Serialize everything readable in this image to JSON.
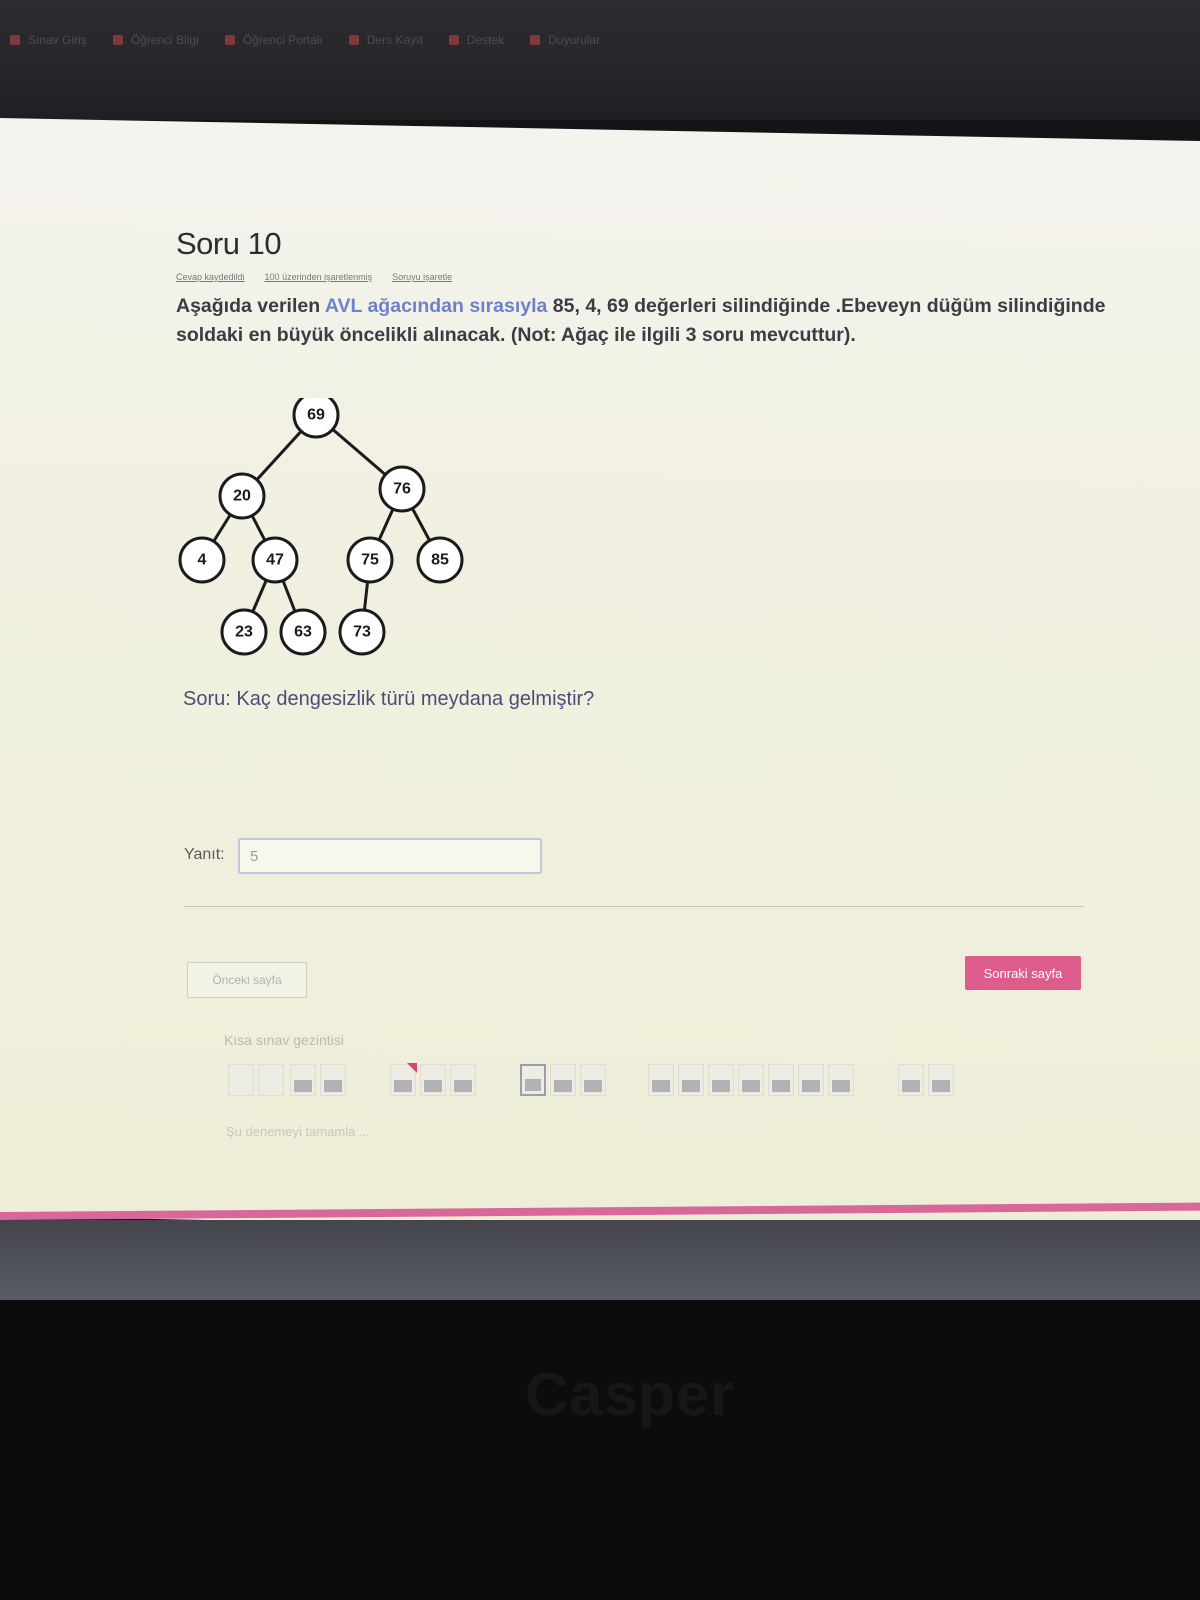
{
  "browser": {
    "bookmarks": [
      "Sınav Giriş",
      "Öğrenci Bilgi",
      "Öğrenci Portalı",
      "Ders Kayıt",
      "Destek",
      "Duyurular"
    ]
  },
  "question": {
    "title": "Soru 10",
    "meta": [
      "Cevap kaydedildi",
      "100 üzerinden işaretlenmiş",
      "Soruyu işaretle"
    ],
    "text_part1": "Aşağıda verilen ",
    "text_blue1": "AVL ağacından sırasıyla",
    "text_part2": " 85, 4, 69 değerleri silindiğinde .Ebeveyn düğüm silindiğinde soldaki en büyük öncelikli alınacak. (Not: Ağaç ile ilgili 3 soru mevcuttur).",
    "soru": "Soru: Kaç dengesizlik türü meydana gelmiştir?"
  },
  "tree": {
    "nodes": {
      "n69": "69",
      "n20": "20",
      "n76": "76",
      "n4": "4",
      "n47": "47",
      "n75": "75",
      "n85": "85",
      "n23": "23",
      "n63": "63",
      "n73": "73"
    }
  },
  "answer": {
    "label": "Yanıt:",
    "value": "5"
  },
  "navigation": {
    "prev_label": "Önceki sayfa",
    "next_label": "Sonraki sayfa",
    "quiz_nav_title": "Kısa sınav gezintisi",
    "finish_label": "Şu denemeyi tamamla ..."
  },
  "branding": {
    "name": "Casper"
  },
  "colors": {
    "accent": "#dc5d8c",
    "text_blue": "#6d82c9"
  }
}
